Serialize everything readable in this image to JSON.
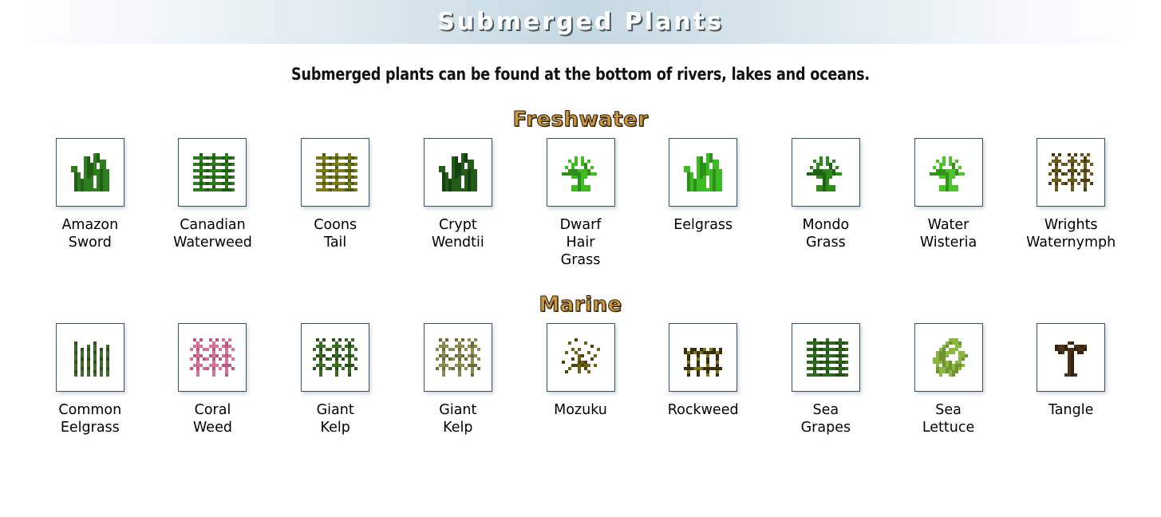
{
  "banner": {
    "title": "Submerged Plants"
  },
  "subtitle": "Submerged plants can be found at the bottom of rivers, lakes and oceans.",
  "colors": {
    "banner_gradient_mid": "#c5d8e2",
    "section_title": "#c99741",
    "section_title_outline": "#2a1c06",
    "tile_border": "#33556b",
    "label_text": "#000000",
    "page_background": "#ffffff"
  },
  "sections": [
    {
      "title": "Freshwater",
      "items": [
        {
          "label": "Amazon\nSword",
          "icon": "amazon-sword-sprite",
          "color": "#2e7d1e",
          "shade": "#206014",
          "shape": "blades"
        },
        {
          "label": "Canadian\nWaterweed",
          "icon": "canadian-waterweed-sprite",
          "color": "#2f7a1c",
          "shade": "#1f5a12",
          "shape": "whorl"
        },
        {
          "label": "Coons\nTail",
          "icon": "coons-tail-sprite",
          "color": "#7e7a18",
          "shade": "#4d5c12",
          "shape": "whorl"
        },
        {
          "label": "Crypt\nWendtii",
          "icon": "crypt-wendtii-sprite",
          "color": "#235c18",
          "shade": "#15400f",
          "shape": "blades"
        },
        {
          "label": "Dwarf\nHair\nGrass",
          "icon": "dwarf-hair-grass-sprite",
          "color": "#3fbb22",
          "shade": "#2d8f18",
          "shape": "spray"
        },
        {
          "label": "Eelgrass",
          "icon": "eelgrass-sprite",
          "color": "#3dbb22",
          "shade": "#2b9016",
          "shape": "blades"
        },
        {
          "label": "Mondo\nGrass",
          "icon": "mondo-grass-sprite",
          "color": "#2f8a1c",
          "shade": "#1f6212",
          "shape": "spray"
        },
        {
          "label": "Water\nWisteria",
          "icon": "water-wisteria-sprite",
          "color": "#4cc42a",
          "shade": "#339318",
          "shape": "spray"
        },
        {
          "label": "Wrights\nWaternymph",
          "icon": "wrights-waternymph-sprite",
          "color": "#6b5a1e",
          "shade": "#4a3d12",
          "shape": "branch"
        }
      ]
    },
    {
      "title": "Marine",
      "items": [
        {
          "label": "Common\nEelgrass",
          "icon": "common-eelgrass-sprite",
          "color": "#3d6b2a",
          "shade": "#2b4d1c",
          "shape": "strands"
        },
        {
          "label": "Coral\nWeed",
          "icon": "coral-weed-sprite",
          "color": "#d4729a",
          "shade": "#b85a80",
          "shape": "branch"
        },
        {
          "label": "Giant\nKelp",
          "icon": "giant-kelp-sprite",
          "color": "#3a6b24",
          "shade": "#284d18",
          "shape": "branch"
        },
        {
          "label": "Giant\nKelp",
          "icon": "giant-kelp-sprite-2",
          "color": "#8a8a52",
          "shade": "#6b6b3a",
          "shape": "branch"
        },
        {
          "label": "Mozuku",
          "icon": "mozuku-sprite",
          "color": "#6e6215",
          "shade": "#4e450f",
          "shape": "scatter"
        },
        {
          "label": "Rockweed",
          "icon": "rockweed-sprite",
          "color": "#3a2e0c",
          "shade": "#7d7418",
          "shape": "posts"
        },
        {
          "label": "Sea\nGrapes",
          "icon": "sea-grapes-sprite",
          "color": "#2f6b1c",
          "shade": "#1f4d12",
          "shape": "whorl"
        },
        {
          "label": "Sea\nLettuce",
          "icon": "sea-lettuce-sprite",
          "color": "#8ab73e",
          "shade": "#6d9430",
          "shape": "ribbon"
        },
        {
          "label": "Tangle",
          "icon": "tangle-sprite",
          "color": "#4a3318",
          "shade": "#33220f",
          "shape": "tree"
        }
      ]
    }
  ]
}
